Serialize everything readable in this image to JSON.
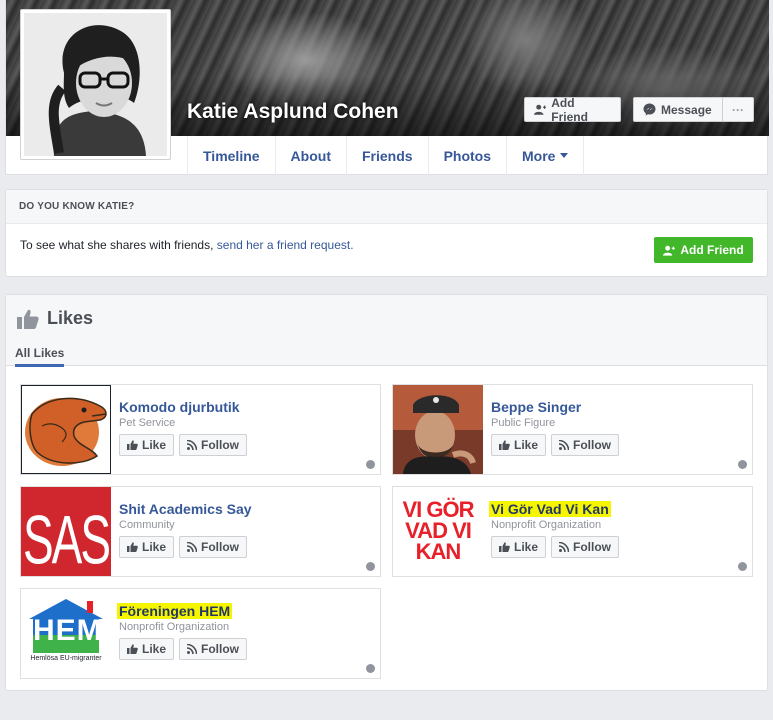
{
  "profile": {
    "name": "Katie Asplund Cohen",
    "add_friend_label": "Add Friend",
    "message_label": "Message",
    "more_options_label": "···",
    "tabs": [
      {
        "label": "Timeline"
      },
      {
        "label": "About"
      },
      {
        "label": "Friends"
      },
      {
        "label": "Photos"
      },
      {
        "label": "More"
      }
    ]
  },
  "know": {
    "heading": "DO YOU KNOW KATIE?",
    "text": "To see what she shares with friends,",
    "link": "send her a friend request.",
    "button_label": "Add Friend"
  },
  "likes": {
    "title": "Likes",
    "filter_tab": "All Likes",
    "like_label": "Like",
    "follow_label": "Follow",
    "items": [
      {
        "name": "Komodo djurbutik",
        "category": "Pet Service",
        "highlighted": false
      },
      {
        "name": "Beppe Singer",
        "category": "Public Figure",
        "highlighted": false
      },
      {
        "name": "Shit Academics Say",
        "category": "Community",
        "highlighted": false,
        "logo_text": "SAS"
      },
      {
        "name": "Vi Gör Vad Vi Kan",
        "category": "Nonprofit Organization",
        "highlighted": true,
        "logo_lines": [
          "VI GÖR",
          "VAD VI",
          "KAN"
        ]
      },
      {
        "name": "Föreningen HEM",
        "category": "Nonprofit Organization",
        "highlighted": true,
        "logo_text": "HEM",
        "logo_caption": "Hemlösa EU-migranter"
      }
    ]
  },
  "colors": {
    "link": "#365899",
    "green": "#42b72a",
    "highlight": "#f5f500",
    "sas_red": "#d0262e",
    "vgvvk_red": "#e8202a"
  },
  "icons": {
    "add_friend": "person-plus-icon",
    "message": "messenger-icon",
    "like": "thumbs-up-icon",
    "follow": "rss-icon",
    "likes_header": "thumbs-up-icon",
    "privacy": "globe-icon",
    "more_caret": "caret-down-icon"
  }
}
